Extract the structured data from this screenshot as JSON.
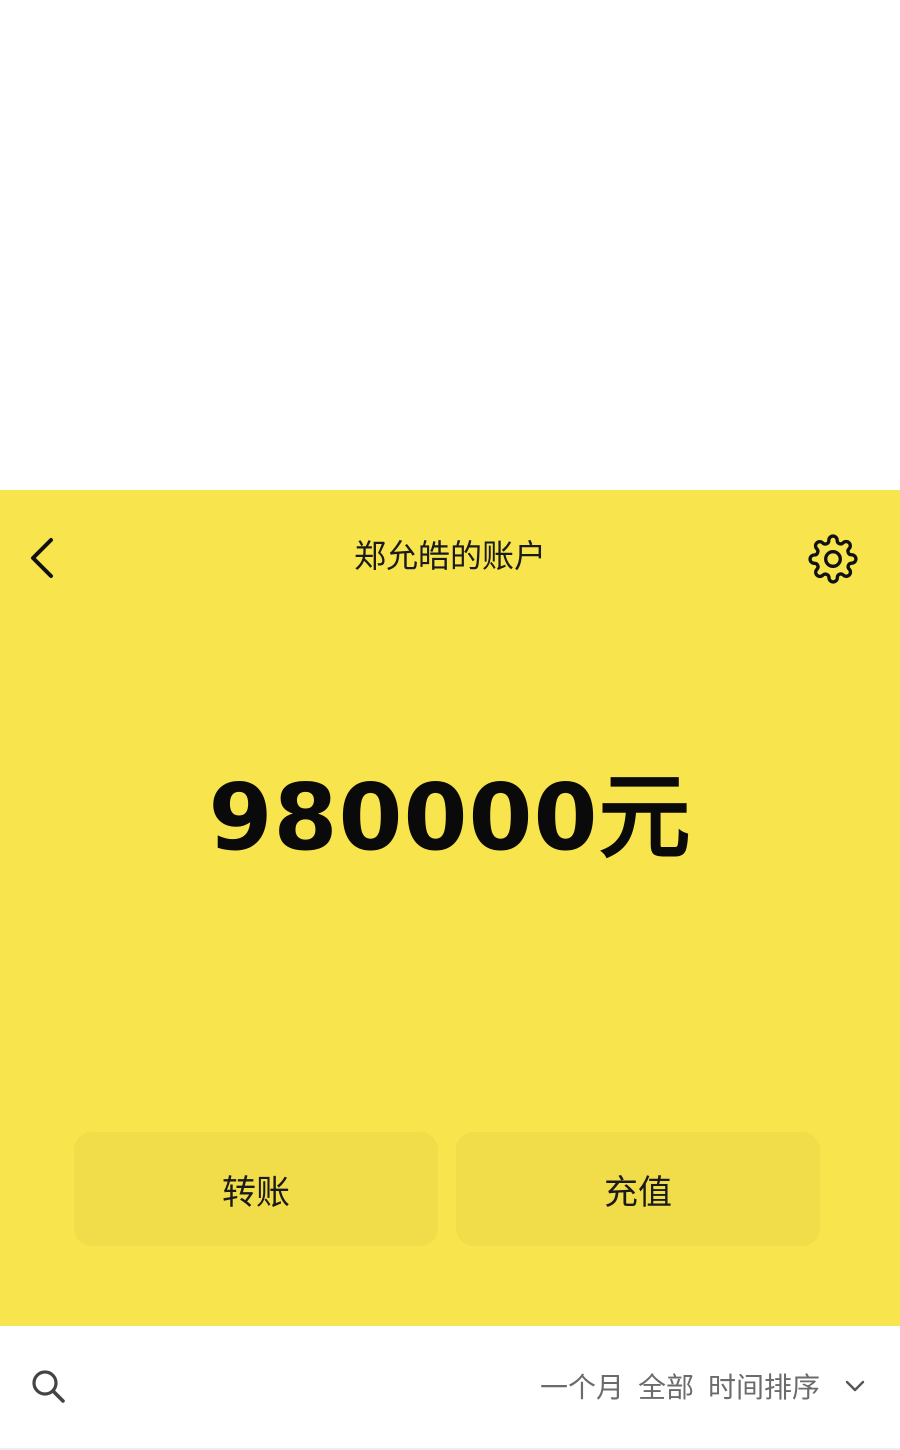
{
  "header": {
    "title": "郑允皓的账户",
    "back_icon": "chevron-left-icon",
    "settings_icon": "gear-icon"
  },
  "balance": {
    "amount_display": "980000元"
  },
  "actions": {
    "transfer_label": "转账",
    "recharge_label": "充值"
  },
  "filter_bar": {
    "search_icon": "search-icon",
    "period": "一个月",
    "type": "全部",
    "sort": "时间排序",
    "dropdown_icon": "chevron-down-icon"
  },
  "colors": {
    "panel_background": "#f8e44c",
    "text_primary": "#1a1a1a",
    "filter_text": "#6b6b6b"
  }
}
